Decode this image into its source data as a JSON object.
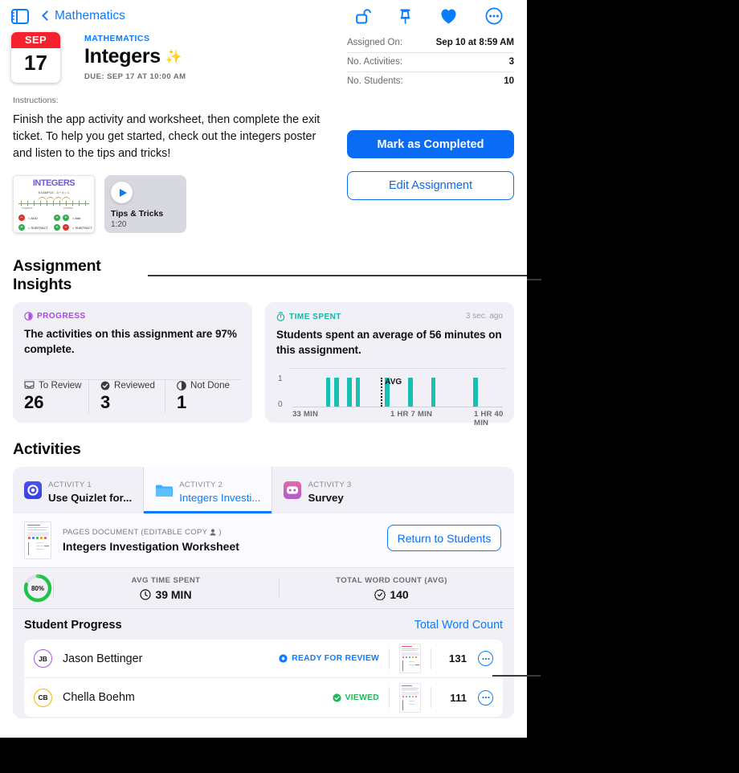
{
  "nav": {
    "sidebar_icon": "sidebar-toggle-icon",
    "back_label": "Mathematics",
    "icons": [
      "unlock-icon",
      "pin-icon",
      "heart-icon",
      "more-circle-icon"
    ]
  },
  "header": {
    "date_month": "SEP",
    "date_day": "17",
    "eyebrow": "MATHEMATICS",
    "title": "Integers",
    "sparkle": "✨",
    "due": "DUE: SEP 17 AT 10:00 AM",
    "meta": [
      {
        "key": "Assigned On:",
        "value": "Sep 10 at 8:59 AM"
      },
      {
        "key": "No. Activities:",
        "value": "3"
      },
      {
        "key": "No. Students:",
        "value": "10"
      }
    ],
    "mark_completed": "Mark as Completed",
    "edit_assignment": "Edit Assignment"
  },
  "instructions": {
    "label": "Instructions:",
    "body": "Finish the app activity and worksheet, then complete the exit ticket. To help you get started, check out the integers poster and listen to the tips and tricks!"
  },
  "attachments": {
    "poster": {
      "title": "INTEGERS",
      "example": "EXAMPLE: -3 + 4 = 1",
      "left_label": "negative",
      "right_label": "positive",
      "rows": [
        {
          "a": "−",
          "b": "= ADD",
          "c": "+",
          "d": "+",
          "e": "= Add"
        },
        {
          "a": "+",
          "b": "= SUBTRACT",
          "c": "+",
          "d": "−",
          "e": "= SUBTRACT"
        }
      ]
    },
    "video": {
      "title": "Tips & Tricks",
      "duration": "1:20",
      "icon": "play-icon"
    }
  },
  "insights": {
    "heading": "Assignment Insights",
    "progress": {
      "kicker": "PROGRESS",
      "kicker_icon": "progress-circle-icon",
      "headline": "The activities on this assignment are 97% complete.",
      "stats": [
        {
          "icon": "tray-icon",
          "label": "To Review",
          "value": "26"
        },
        {
          "icon": "check-circle-icon",
          "label": "Reviewed",
          "value": "3"
        },
        {
          "icon": "half-circle-icon",
          "label": "Not Done",
          "value": "1"
        }
      ]
    },
    "time": {
      "kicker": "TIME SPENT",
      "kicker_icon": "stopwatch-icon",
      "ago": "3 sec. ago",
      "headline": "Students spent an average of 56 minutes on this assignment."
    }
  },
  "chart_data": {
    "type": "bar",
    "title": "Time Spent",
    "xlabel": "",
    "ylabel": "",
    "ylim": [
      0,
      1
    ],
    "yticks": [
      "0",
      "1"
    ],
    "xticks": [
      "33 MIN",
      "1 HR 7 MIN",
      "1 HR 40 MIN"
    ],
    "xtick_positions_pct": [
      3,
      50,
      93
    ],
    "grid": false,
    "legend": false,
    "bar_color": "#17c0b0",
    "annotation": {
      "label": "AVG",
      "position_pct": 42,
      "style": "dotted-vertical"
    },
    "bars": [
      {
        "x_pct": 16,
        "value": 1
      },
      {
        "x_pct": 20,
        "value": 1
      },
      {
        "x_pct": 26,
        "value": 1
      },
      {
        "x_pct": 30,
        "value": 1
      },
      {
        "x_pct": 44,
        "value": 1
      },
      {
        "x_pct": 55,
        "value": 1
      },
      {
        "x_pct": 66,
        "value": 1
      },
      {
        "x_pct": 86,
        "value": 1
      }
    ]
  },
  "activities": {
    "heading": "Activities",
    "tabs": [
      {
        "index": "ACTIVITY 1",
        "label": "Use Quizlet for...",
        "icon": "quizlet-app-icon",
        "active": false
      },
      {
        "index": "ACTIVITY 2",
        "label": "Integers Investi...",
        "icon": "folder-icon",
        "active": true
      },
      {
        "index": "ACTIVITY 3",
        "label": "Survey",
        "icon": "survey-app-icon",
        "active": false
      }
    ],
    "document": {
      "type_label": "PAGES DOCUMENT (EDITABLE COPY",
      "type_label_suffix": ")",
      "person_icon": "person-fill-icon",
      "name": "Integers Investigation Worksheet",
      "return_button": "Return to Students",
      "thumb_icon": "document-thumbnail"
    },
    "summary": {
      "ring_pct": "80%",
      "ring_value": 80,
      "cells": [
        {
          "label": "AVG TIME SPENT",
          "icon": "clock-icon",
          "value": "39 MIN"
        },
        {
          "label": "TOTAL WORD COUNT (AVG)",
          "icon": "wordcount-badge-icon",
          "value": "140"
        }
      ]
    },
    "student_progress": {
      "title": "Student Progress",
      "action": "Total Word Count",
      "students": [
        {
          "initials": "JB",
          "avatar_color": "#a855d6",
          "name": "Jason Bettinger",
          "status": "READY FOR REVIEW",
          "status_color": "#0a7cff",
          "status_icon": "ready-dot-icon",
          "words": "131",
          "more_icon": "more-circle-icon"
        },
        {
          "initials": "CB",
          "avatar_color": "#f2b705",
          "name": "Chella Boehm",
          "status": "VIEWED",
          "status_color": "#1db954",
          "status_icon": "viewed-check-icon",
          "words": "111",
          "more_icon": "more-circle-icon"
        }
      ]
    }
  }
}
